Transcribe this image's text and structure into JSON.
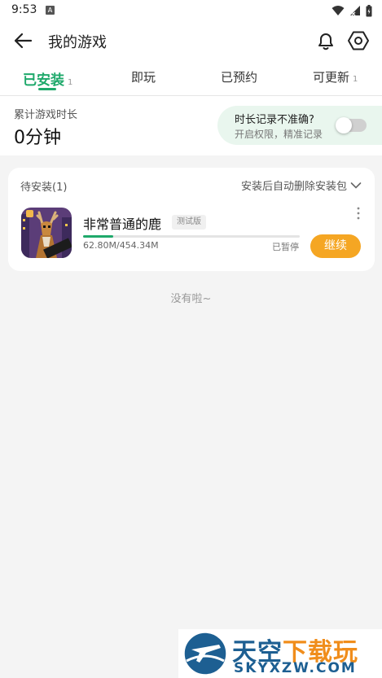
{
  "status_bar": {
    "time": "9:53",
    "notification_badge": "A",
    "icons": [
      "wifi-icon",
      "signal-icon",
      "battery-icon"
    ]
  },
  "header": {
    "title": "我的游戏",
    "icons": [
      "back-arrow-icon",
      "bell-icon",
      "settings-hexagon-icon"
    ]
  },
  "tabs": [
    {
      "label": "已安装",
      "count": "1",
      "active": true
    },
    {
      "label": "即玩",
      "count": "",
      "active": false
    },
    {
      "label": "已预约",
      "count": "",
      "active": false
    },
    {
      "label": "可更新",
      "count": "1",
      "active": false
    }
  ],
  "playtime": {
    "label": "累计游戏时长",
    "value": "0分钟",
    "hint_title": "时长记录不准确?",
    "hint_subtitle": "开启权限，精准记录",
    "toggle_on": false
  },
  "pending_install": {
    "section_title": "待安装(1)",
    "auto_delete_label": "安装后自动删除安装包",
    "game": {
      "name": "非常普通的鹿",
      "badge": "测试版",
      "size": "62.80M/454.34M",
      "progress": 0.138,
      "status": "已暂停",
      "action_label": "继续",
      "icon_text": "Deer"
    }
  },
  "empty_message": "没有啦~",
  "watermark": {
    "title_main": "天空",
    "title_accent": "下载玩",
    "subtitle": "SKYXZW.COM"
  },
  "colors": {
    "accent_green": "#1fa96b",
    "button_orange": "#f5a623",
    "hint_bg": "#e9f6ee",
    "watermark_blue": "#1d5f92",
    "watermark_orange": "#f08d1b"
  }
}
